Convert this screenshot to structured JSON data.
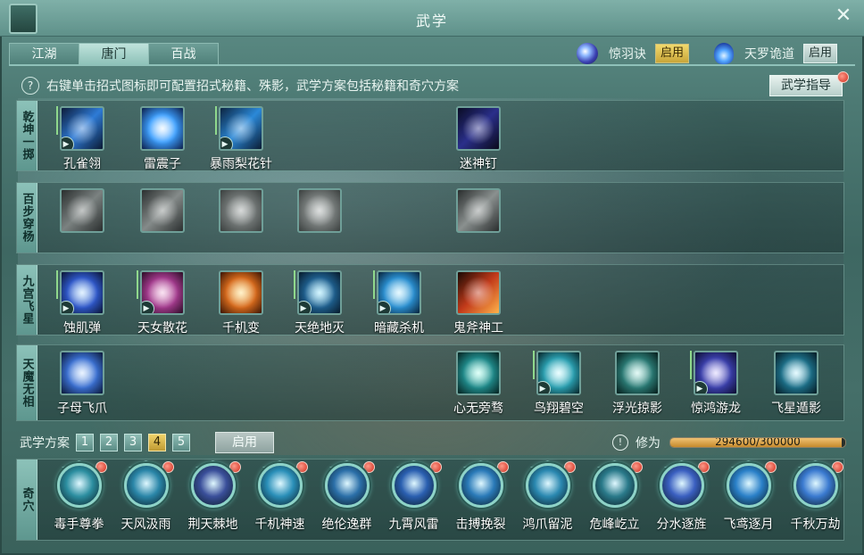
{
  "window": {
    "title": "武学"
  },
  "tabs": [
    {
      "label": "江湖"
    },
    {
      "label": "唐门"
    },
    {
      "label": "百战"
    }
  ],
  "active_tab": "唐门",
  "toggles": [
    {
      "label": "惊羽诀",
      "button": "启用",
      "state": "on"
    },
    {
      "label": "天罗诡道",
      "button": "启用",
      "state": "off"
    }
  ],
  "hint": "右键单击招式图标即可配置招式秘籍、殊影，武学方案包括秘籍和奇穴方案",
  "guide_button": "武学指导",
  "help_glyph": "?",
  "rows": [
    {
      "label": "乾坤一掷",
      "skills": [
        {
          "name": "孔雀翎",
          "color": "#2e7bd6",
          "marker": true
        },
        {
          "name": "雷震子",
          "color": "#3da0ff",
          "marker": false
        },
        {
          "name": "暴雨梨花针",
          "color": "#2b89d8",
          "marker": true
        },
        {
          "name": "迷神钉",
          "color": "#2a2f8a",
          "marker": false
        }
      ]
    },
    {
      "label": "百步穿杨",
      "skills": [
        {
          "name": "",
          "color": "#555b5a"
        },
        {
          "name": "",
          "color": "#5c6261"
        },
        {
          "name": "",
          "color": "#4c5251"
        },
        {
          "name": "",
          "color": "#555b5a"
        },
        {
          "name": "",
          "color": "#4c5251"
        }
      ]
    },
    {
      "label": "九宫飞星",
      "skills": [
        {
          "name": "蚀肌弹",
          "color": "#2e57c8",
          "marker": true
        },
        {
          "name": "天女散花",
          "color": "#a23a8c",
          "marker": true
        },
        {
          "name": "千机变",
          "color": "#d66a1c",
          "marker": false
        },
        {
          "name": "天绝地灭",
          "color": "#1e5f8e",
          "marker": true
        },
        {
          "name": "暗藏杀机",
          "color": "#2a8fd0",
          "marker": true
        },
        {
          "name": "鬼斧神工",
          "color": "#c23a1a",
          "marker": false
        }
      ]
    },
    {
      "label": "天魔无相",
      "skills": [
        {
          "name": "子母飞爪",
          "color": "#3a6fd0",
          "marker": false
        },
        {
          "name": "心无旁骛",
          "color": "#1f8a8a",
          "marker": false
        },
        {
          "name": "鸟翔碧空",
          "color": "#2a9fb0",
          "marker": true
        },
        {
          "name": "浮光掠影",
          "color": "#2a7a74",
          "marker": false
        },
        {
          "name": "惊鸿游龙",
          "color": "#3a3faa",
          "marker": true
        },
        {
          "name": "飞星遁影",
          "color": "#1c6f88",
          "marker": false
        }
      ]
    }
  ],
  "plan": {
    "label": "武学方案",
    "numbers": [
      "1",
      "2",
      "3",
      "4",
      "5"
    ],
    "active": "4",
    "enable_button": "启用"
  },
  "xiuwei": {
    "label": "修为",
    "value": 294600,
    "max": 300000,
    "text": "294600/300000",
    "glyph": "!"
  },
  "qixue": {
    "label": "奇穴",
    "skills": [
      {
        "name": "毒手尊拳",
        "color": "#2c8ea0"
      },
      {
        "name": "天风汲雨",
        "color": "#2a86a8"
      },
      {
        "name": "荆天棘地",
        "color": "#3a4f9a"
      },
      {
        "name": "千机神速",
        "color": "#2a8fb8"
      },
      {
        "name": "绝伦逸群",
        "color": "#2b6fa8"
      },
      {
        "name": "九霄风雷",
        "color": "#2a5fb0"
      },
      {
        "name": "击搏挽裂",
        "color": "#2a7ab8"
      },
      {
        "name": "鸿爪留泥",
        "color": "#2a88b0"
      },
      {
        "name": "危峰屹立",
        "color": "#2a7a8a"
      },
      {
        "name": "分水逐旌",
        "color": "#3a5fc0"
      },
      {
        "name": "飞鸢逐月",
        "color": "#2a80c8"
      },
      {
        "name": "千秋万劫",
        "color": "#3a7ad0"
      }
    ]
  }
}
